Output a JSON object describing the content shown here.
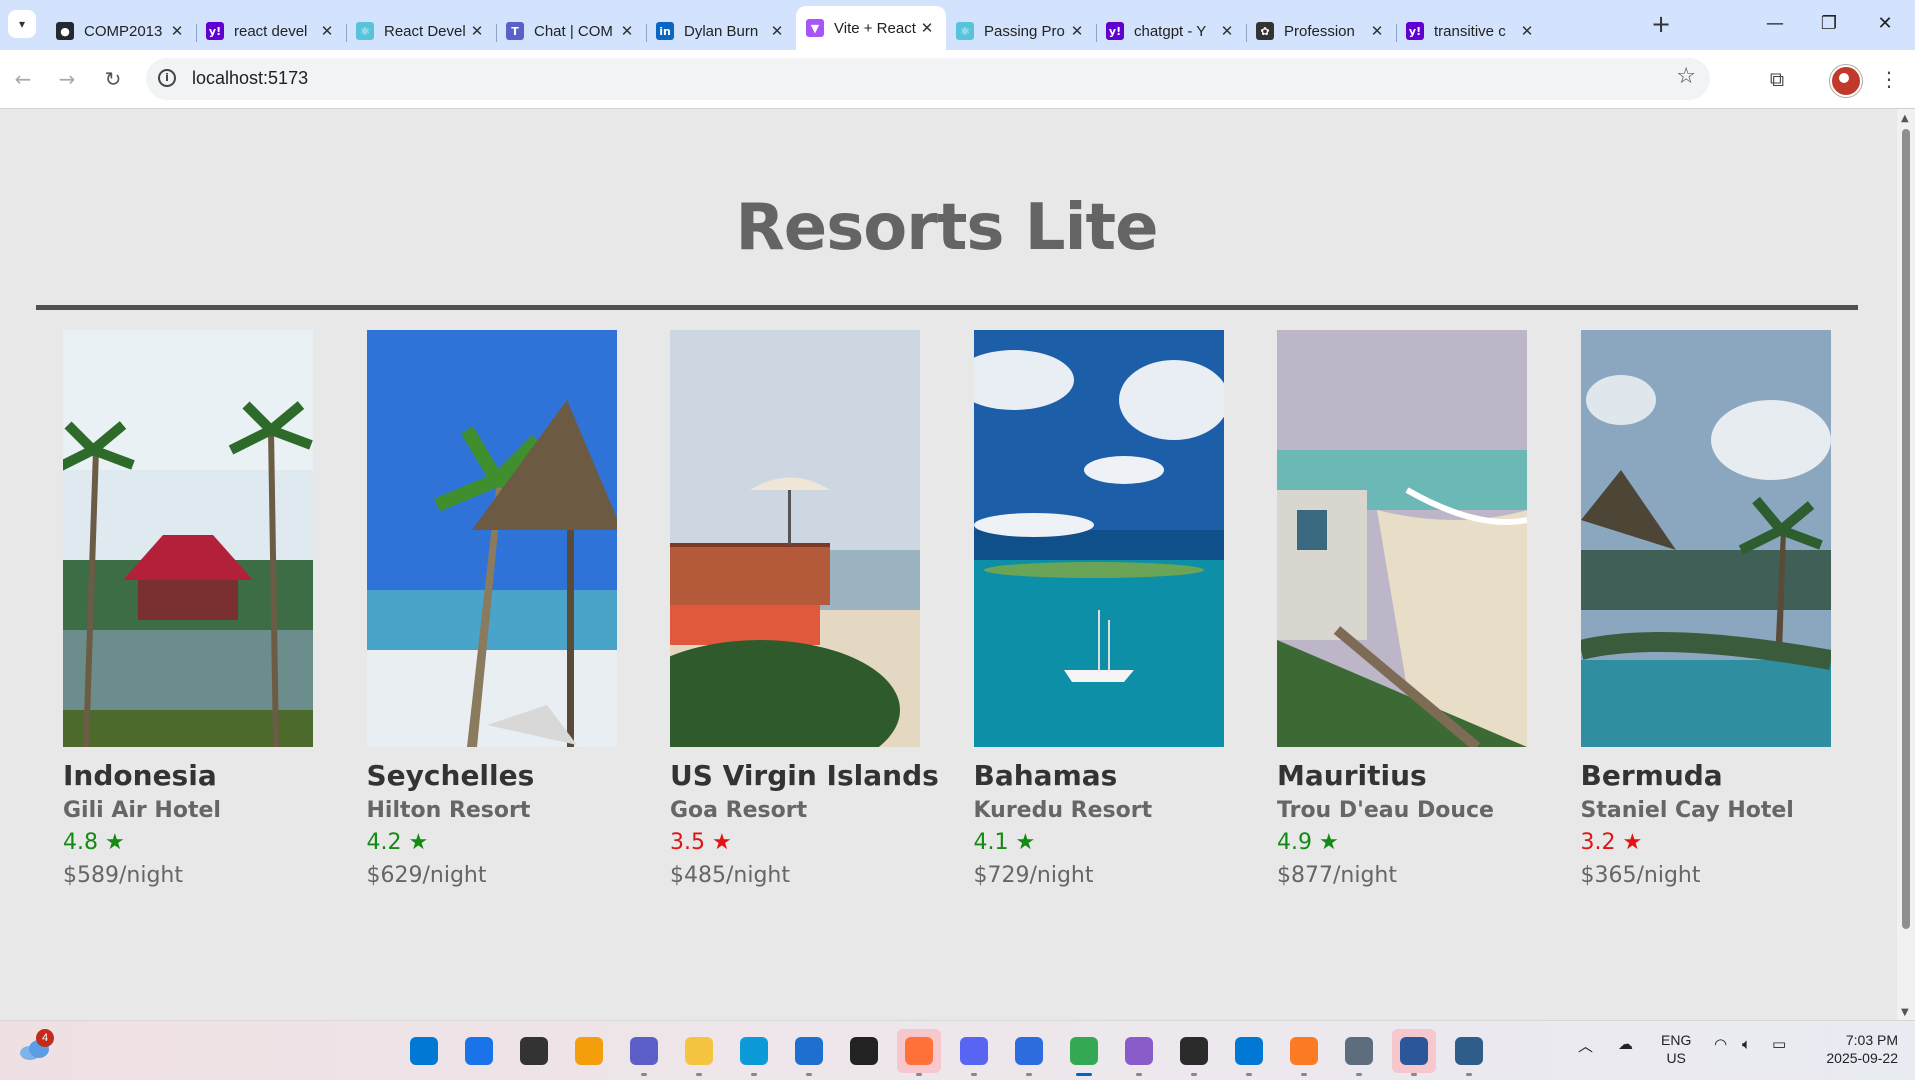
{
  "browser": {
    "tabs": [
      {
        "title": "COMP2013",
        "icon": "github-icon",
        "color": "#24292f",
        "glyph": "●"
      },
      {
        "title": "react devel",
        "icon": "yahoo-icon",
        "color": "#6001d2",
        "glyph": "y!"
      },
      {
        "title": "React Devel",
        "icon": "react-icon",
        "color": "#58c4dc",
        "glyph": "⚛"
      },
      {
        "title": "Chat | COM",
        "icon": "teams-icon",
        "color": "#5b5fc7",
        "glyph": "T"
      },
      {
        "title": "Dylan Burn",
        "icon": "linkedin-icon",
        "color": "#0a66c2",
        "glyph": "in"
      },
      {
        "title": "Vite + React",
        "icon": "vite-icon",
        "color": "#a855f7",
        "glyph": "▼",
        "active": true
      },
      {
        "title": "Passing Pro",
        "icon": "react-icon",
        "color": "#58c4dc",
        "glyph": "⚛"
      },
      {
        "title": "chatgpt - Y",
        "icon": "yahoo-icon",
        "color": "#6001d2",
        "glyph": "y!"
      },
      {
        "title": "Profession",
        "icon": "openai-icon",
        "color": "#333333",
        "glyph": "✿"
      },
      {
        "title": "transitive c",
        "icon": "yahoo-icon",
        "color": "#6001d2",
        "glyph": "y!"
      }
    ],
    "url": "localhost:5173"
  },
  "page": {
    "title": "Resorts Lite"
  },
  "resorts": [
    {
      "country": "Indonesia",
      "hotel": "Gili Air Hotel",
      "rating": "4.8 ★",
      "rating_color": "#138a13",
      "price": "$589/night",
      "image": "tropical-pool-palms"
    },
    {
      "country": "Seychelles",
      "hotel": "Hilton Resort",
      "rating": "4.2 ★",
      "rating_color": "#138a13",
      "price": "$629/night",
      "image": "beach-thatched-umbrella"
    },
    {
      "country": "US Virgin Islands",
      "hotel": "Goa Resort",
      "rating": "3.5 ★",
      "rating_color": "#e01414",
      "price": "$485/night",
      "image": "beach-deck-umbrellas"
    },
    {
      "country": "Bahamas",
      "hotel": "Kuredu Resort",
      "rating": "4.1 ★",
      "rating_color": "#138a13",
      "price": "$729/night",
      "image": "ocean-sailboat"
    },
    {
      "country": "Mauritius",
      "hotel": "Trou D'eau Douce",
      "rating": "4.9 ★",
      "rating_color": "#138a13",
      "price": "$877/night",
      "image": "coast-cliff-villa"
    },
    {
      "country": "Bermuda",
      "hotel": "Staniel Cay Hotel",
      "rating": "3.2 ★",
      "rating_color": "#e01414",
      "price": "$365/night",
      "image": "infinity-pool-hut"
    }
  ],
  "taskbar": {
    "weather_badge": "4",
    "apps": [
      {
        "name": "windows-start-icon",
        "color": "#0078d4"
      },
      {
        "name": "search-icon",
        "color": "#1a73e8"
      },
      {
        "name": "task-view-icon",
        "color": "#333333"
      },
      {
        "name": "copilot-icon",
        "color": "#f59e0b"
      },
      {
        "name": "teams-icon",
        "color": "#5b5fc7"
      },
      {
        "name": "file-explorer-icon",
        "color": "#f5c542"
      },
      {
        "name": "edge-icon",
        "color": "#0c9bd8"
      },
      {
        "name": "store-icon",
        "color": "#1f6fd1"
      },
      {
        "name": "dell-icon",
        "color": "#222222"
      },
      {
        "name": "firefox-icon",
        "color": "#ff7139",
        "highlight": true
      },
      {
        "name": "discord-icon",
        "color": "#5865f2"
      },
      {
        "name": "app-icon",
        "color": "#2d6cdf"
      },
      {
        "name": "chrome-icon",
        "color": "#34a853",
        "active": true
      },
      {
        "name": "visual-studio-icon",
        "color": "#8a5cc9"
      },
      {
        "name": "terminal-icon",
        "color": "#2b2b2b"
      },
      {
        "name": "vscode-icon",
        "color": "#0078d4"
      },
      {
        "name": "xampp-icon",
        "color": "#fb7a24"
      },
      {
        "name": "calculator-icon",
        "color": "#5d6d7e"
      },
      {
        "name": "word-icon",
        "color": "#2b579a",
        "highlight": true
      },
      {
        "name": "remote-icon",
        "color": "#2f5d8a"
      }
    ],
    "lang_1": "ENG",
    "lang_2": "US",
    "time": "7:03 PM",
    "date": "2025-09-22"
  }
}
